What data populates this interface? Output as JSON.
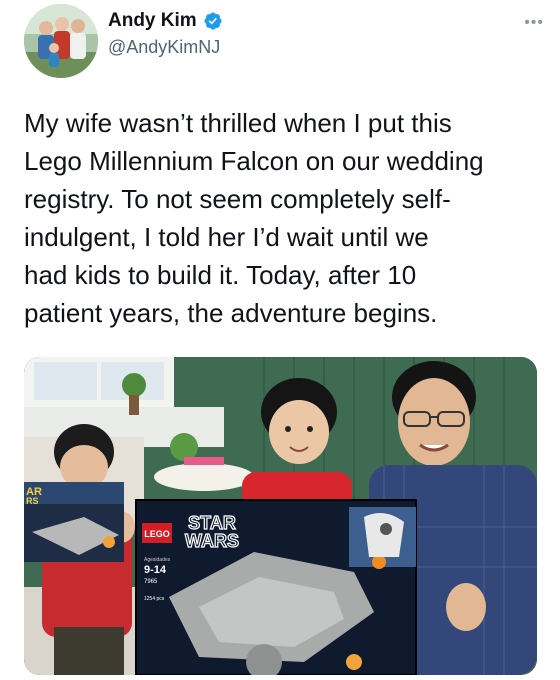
{
  "author": {
    "display_name": "Andy Kim",
    "handle": "@AndyKimNJ",
    "verified": true,
    "avatar_icon": "profile-photo"
  },
  "more_icon": "more-options-icon",
  "tweet": {
    "lines": [
      "My wife wasn’t thrilled when I put this",
      "Lego Millennium Falcon on our wedding",
      "registry. To not seem completely self-",
      "indulgent, I told her I’d wait until we",
      "had kids to build it. Today, after 10",
      "patient years, the adventure begins."
    ]
  },
  "media": {
    "box": {
      "brand": "LEGO",
      "title_line1": "STAR",
      "title_line2": "WARS",
      "age_label": "Agesidades",
      "age_range": "9-14",
      "set_number": "7965",
      "side_title": "AR",
      "side_title2": "RS",
      "piece_count": "1254 pcs"
    }
  },
  "colors": {
    "verified_blue": "#1d9bf0",
    "handle_gray": "#536471",
    "wall_green": "#3f6b53"
  }
}
